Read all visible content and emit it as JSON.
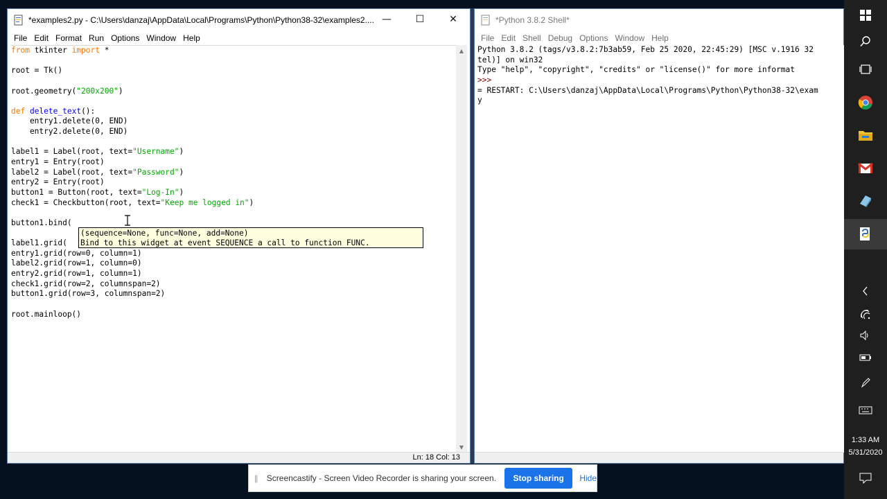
{
  "editor": {
    "title": "*examples2.py - C:\\Users\\danzaj\\AppData\\Local\\Programs\\Python\\Python38-32\\examples2....",
    "menu": [
      "File",
      "Edit",
      "Format",
      "Run",
      "Options",
      "Window",
      "Help"
    ],
    "code_lines": [
      [
        [
          "kw",
          "from"
        ],
        [
          "n",
          " tkinter "
        ],
        [
          "kw",
          "import"
        ],
        [
          "n",
          " *"
        ]
      ],
      [],
      [
        [
          "n",
          "root = Tk()"
        ]
      ],
      [],
      [
        [
          "n",
          "root.geometry("
        ],
        [
          "str",
          "\"200x200\""
        ],
        [
          "n",
          ")"
        ]
      ],
      [],
      [
        [
          "kw",
          "def"
        ],
        [
          "n",
          " "
        ],
        [
          "def",
          "delete_text"
        ],
        [
          "n",
          "():"
        ]
      ],
      [
        [
          "n",
          "    entry1.delete(0, END)"
        ]
      ],
      [
        [
          "n",
          "    entry2.delete(0, END)"
        ]
      ],
      [],
      [
        [
          "n",
          "label1 = Label(root, text="
        ],
        [
          "str",
          "\"Username\""
        ],
        [
          "n",
          ")"
        ]
      ],
      [
        [
          "n",
          "entry1 = Entry(root)"
        ]
      ],
      [
        [
          "n",
          "label2 = Label(root, text="
        ],
        [
          "str",
          "\"Password\""
        ],
        [
          "n",
          ")"
        ]
      ],
      [
        [
          "n",
          "entry2 = Entry(root)"
        ]
      ],
      [
        [
          "n",
          "button1 = Button(root, text="
        ],
        [
          "str",
          "\"Log-In\""
        ],
        [
          "n",
          ")"
        ]
      ],
      [
        [
          "n",
          "check1 = Checkbutton(root, text="
        ],
        [
          "str",
          "\"Keep me logged in\""
        ],
        [
          "n",
          ")"
        ]
      ],
      [],
      [
        [
          "n",
          "button1.bind("
        ]
      ],
      [],
      [
        [
          "n",
          "label1.grid("
        ]
      ],
      [
        [
          "n",
          "entry1.grid(row=0, column=1)"
        ]
      ],
      [
        [
          "n",
          "label2.grid(row=1, column=0)"
        ]
      ],
      [
        [
          "n",
          "entry2.grid(row=1, column=1)"
        ]
      ],
      [
        [
          "n",
          "check1.grid(row=2, columnspan=2)"
        ]
      ],
      [
        [
          "n",
          "button1.grid(row=3, columnspan=2)"
        ]
      ],
      [],
      [
        [
          "n",
          "root.mainloop()"
        ]
      ]
    ],
    "calltip_line1": "(sequence=None, func=None, add=None)",
    "calltip_line2": "Bind to this widget at event SEQUENCE a call to function FUNC.",
    "status": "Ln: 18  Col: 13"
  },
  "shell": {
    "title": "*Python 3.8.2 Shell*",
    "menu": [
      "File",
      "Edit",
      "Shell",
      "Debug",
      "Options",
      "Window",
      "Help"
    ],
    "lines": [
      {
        "cls": "",
        "text": "Python 3.8.2 (tags/v3.8.2:7b3ab59, Feb 25 2020, 22:45:29) [MSC v.1916 32"
      },
      {
        "cls": "",
        "text": "tel)] on win32"
      },
      {
        "cls": "",
        "text": "Type \"help\", \"copyright\", \"credits\" or \"license()\" for more informat"
      },
      {
        "cls": "sh-prompt",
        "text": ">>> "
      },
      {
        "cls": "",
        "text": "= RESTART: C:\\Users\\danzaj\\AppData\\Local\\Programs\\Python\\Python38-32\\exam"
      },
      {
        "cls": "",
        "text": "y"
      }
    ]
  },
  "taskbar": {
    "time": "1:33 AM",
    "date": "5/31/2020"
  },
  "screencastify": {
    "message": "Screencastify - Screen Video Recorder is sharing your screen.",
    "stop_label": "Stop sharing",
    "hide_label": "Hide"
  }
}
